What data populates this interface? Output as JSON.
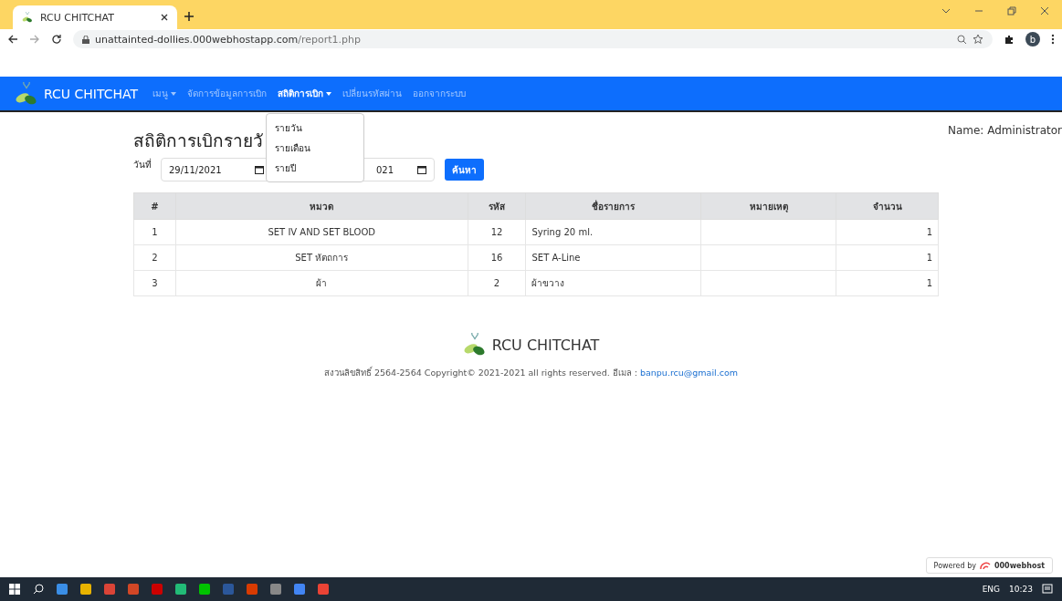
{
  "browser": {
    "tab_title": "RCU CHITCHAT",
    "url_host": "unattainted-dollies.000webhostapp.com",
    "url_path": "/report1.php",
    "profile_initial": "b"
  },
  "navbar": {
    "brand": "RCU CHITCHAT",
    "items": [
      {
        "label": "เมนู",
        "dropdown": true,
        "selected": false
      },
      {
        "label": "จัดการข้อมูลการเบิก",
        "dropdown": false,
        "selected": false
      },
      {
        "label": "สถิติการเบิก",
        "dropdown": true,
        "selected": true
      },
      {
        "label": "เปลี่ยนรหัสผ่าน",
        "dropdown": false,
        "selected": false
      },
      {
        "label": "ออกจากระบบ",
        "dropdown": false,
        "selected": false
      }
    ],
    "open_menu": [
      "รายวัน",
      "รายเดือน",
      "รายปี"
    ]
  },
  "user": "Name: Administrator",
  "page_title": "สถิติการเบิกรายวั",
  "filter": {
    "label": "วันที่",
    "date_from": "29/11/2021",
    "date_to": "021",
    "button": "ค้นหา"
  },
  "table": {
    "columns": [
      "#",
      "หมวด",
      "รหัส",
      "ชื่อรายการ",
      "หมายเหตุ",
      "จำนวน"
    ],
    "rows": [
      [
        "1",
        "SET IV AND SET BLOOD",
        "12",
        "Syring 20 ml.",
        "",
        "1"
      ],
      [
        "2",
        "SET หัตถการ",
        "16",
        "SET A-Line",
        "",
        "1"
      ],
      [
        "3",
        "ผ้า",
        "2",
        "ผ้าขวาง",
        "",
        "1"
      ]
    ]
  },
  "footer": {
    "brand": "RCU CHITCHAT",
    "text": "สงวนลิขสิทธิ์ 2564-2564 Copyright© 2021-2021 all rights reserved. อีเมล : ",
    "email": "banpu.rcu@gmail.com"
  },
  "powered_by": {
    "prefix": "Powered by",
    "name": "000webhost"
  },
  "taskbar": {
    "lang": "ENG",
    "time": "10:23"
  }
}
